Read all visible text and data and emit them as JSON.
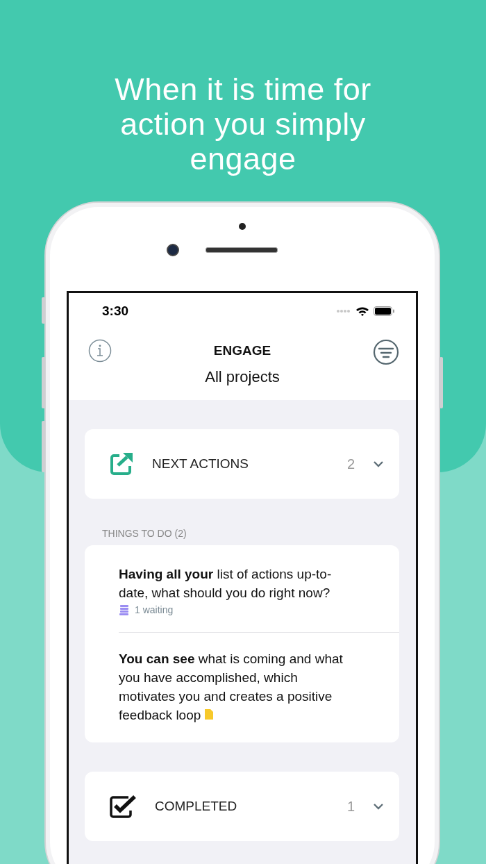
{
  "headline": "When it is time for action you simply engage",
  "status_bar": {
    "time": "3:30"
  },
  "nav": {
    "title": "ENGAGE",
    "subtitle": "All projects"
  },
  "blocks": [
    {
      "kind": "actions",
      "label": "NEXT ACTIONS",
      "count": "2"
    },
    {
      "kind": "list",
      "header": "THINGS TO DO (2)",
      "items": [
        {
          "text": "**Having all your** list of actions up-to-date, what should you do right now?",
          "note": "1 waiting",
          "attachment": false
        },
        {
          "text": "**You can see** what is coming and what you have accomplished, which motivates you and creates a positive feedback loop",
          "attachment": true
        }
      ]
    },
    {
      "kind": "completed",
      "label": "COMPLETED",
      "count": "1"
    }
  ]
}
